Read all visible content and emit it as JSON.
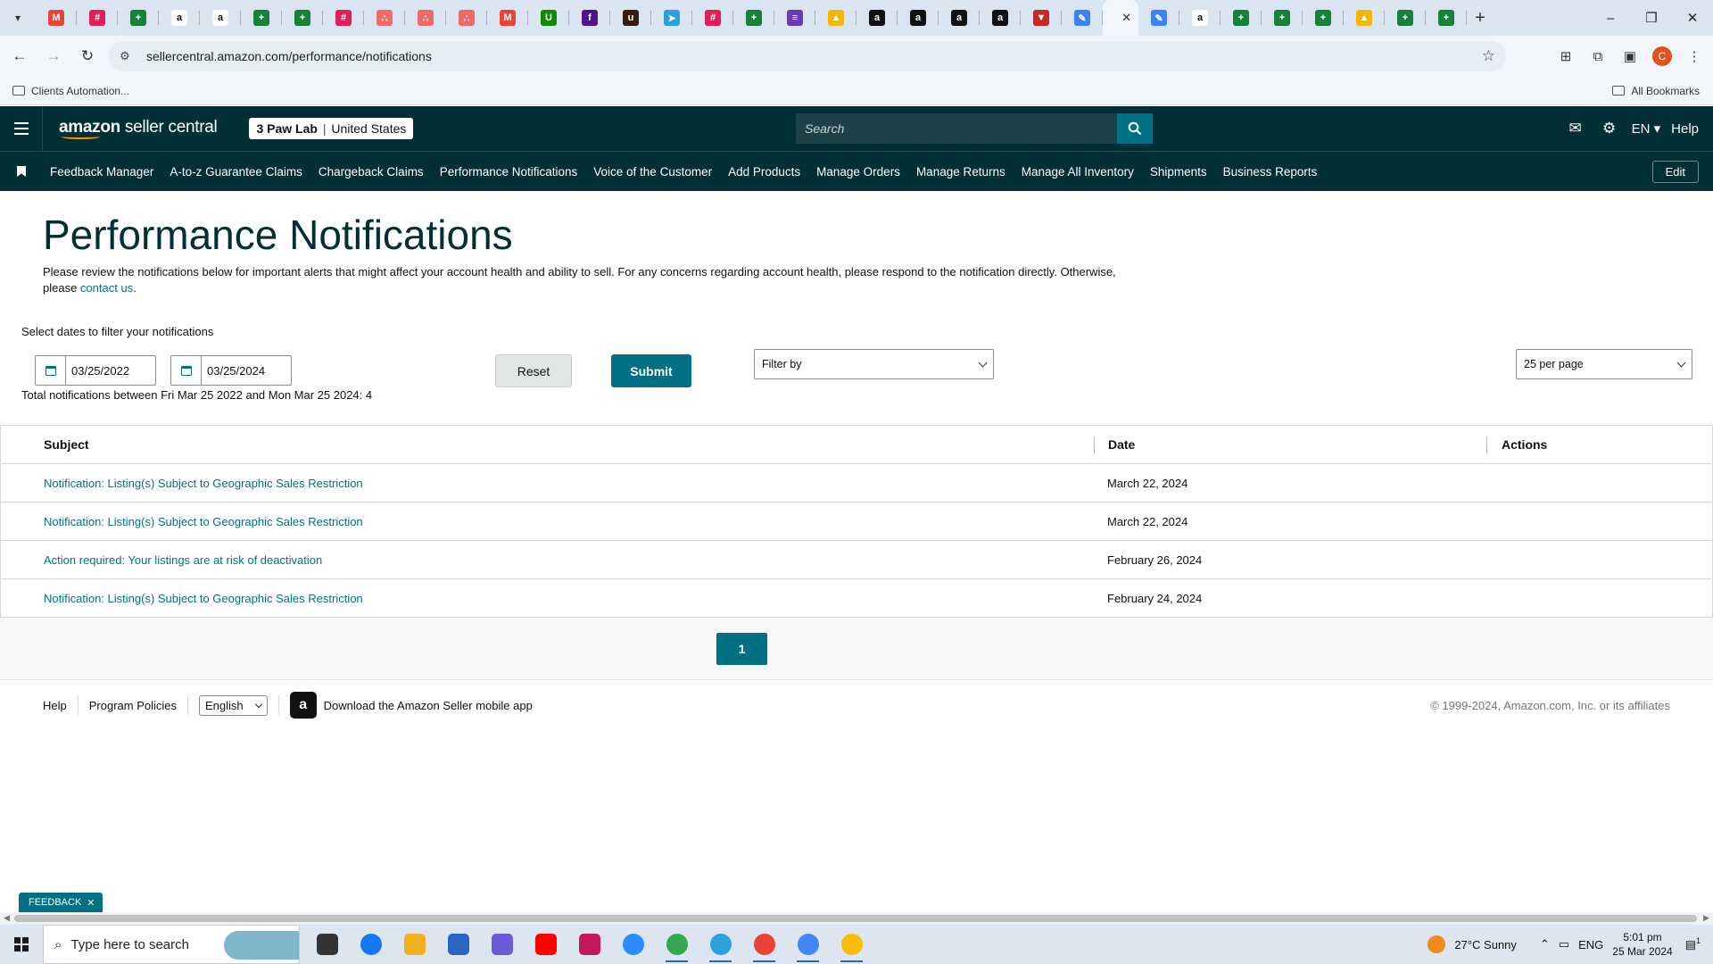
{
  "browser": {
    "url": "sellercentral.amazon.com/performance/notifications",
    "bookmarks": {
      "folder": "Clients Automation...",
      "all": "All Bookmarks"
    },
    "profile_initial": "C",
    "pinned_tabs": [
      {
        "icon": "gmail-icon",
        "color": "#ea4335",
        "glyph": "M"
      },
      {
        "icon": "slack-icon",
        "color": "#e01e5a",
        "glyph": "#"
      },
      {
        "icon": "sheets-icon",
        "color": "#188038",
        "glyph": "+"
      },
      {
        "icon": "amazon-icon",
        "color": "#ffffff",
        "glyph": "a"
      },
      {
        "icon": "amazon-icon",
        "color": "#ffffff",
        "glyph": "a"
      },
      {
        "icon": "sheets-icon",
        "color": "#188038",
        "glyph": "+"
      },
      {
        "icon": "sheets-icon",
        "color": "#188038",
        "glyph": "+"
      },
      {
        "icon": "slack-icon",
        "color": "#e01e5a",
        "glyph": "#"
      },
      {
        "icon": "asana-icon",
        "color": "#f06a6a",
        "glyph": "∴"
      },
      {
        "icon": "asana-icon",
        "color": "#f06a6a",
        "glyph": "∴"
      },
      {
        "icon": "asana-icon",
        "color": "#f06a6a",
        "glyph": "∴"
      },
      {
        "icon": "gmail-icon",
        "color": "#ea4335",
        "glyph": "M"
      },
      {
        "icon": "upwork-icon",
        "color": "#108a00",
        "glyph": "U"
      },
      {
        "icon": "fedex-icon",
        "color": "#4d148c",
        "glyph": "f"
      },
      {
        "icon": "ups-icon",
        "color": "#351c15",
        "glyph": "u"
      },
      {
        "icon": "telegram-icon",
        "color": "#2aa1da",
        "glyph": "➤"
      },
      {
        "icon": "slack-icon",
        "color": "#e01e5a",
        "glyph": "#"
      },
      {
        "icon": "sheets-icon",
        "color": "#188038",
        "glyph": "+"
      },
      {
        "icon": "forms-icon",
        "color": "#673ab7",
        "glyph": "≡"
      },
      {
        "icon": "drive-icon",
        "color": "#f4b400",
        "glyph": "▲"
      },
      {
        "icon": "amazon-icon",
        "color": "#111111",
        "glyph": "a"
      },
      {
        "icon": "amazon-icon",
        "color": "#111111",
        "glyph": "a"
      },
      {
        "icon": "amazon-icon",
        "color": "#111111",
        "glyph": "a"
      },
      {
        "icon": "amazon-icon",
        "color": "#111111",
        "glyph": "a"
      },
      {
        "icon": "red-shield-icon",
        "color": "#c62828",
        "glyph": "▼"
      },
      {
        "icon": "pencil-icon",
        "color": "#3b82f6",
        "glyph": "✎"
      },
      {
        "icon": "active-tab-icon",
        "color": "#f2f6fb",
        "glyph": "",
        "active": true
      },
      {
        "icon": "pencil-icon",
        "color": "#3b82f6",
        "glyph": "✎"
      },
      {
        "icon": "amazon-icon",
        "color": "#ffffff",
        "glyph": "a"
      },
      {
        "icon": "sheets-icon",
        "color": "#188038",
        "glyph": "+"
      },
      {
        "icon": "sheets-icon",
        "color": "#188038",
        "glyph": "+"
      },
      {
        "icon": "sheets-icon",
        "color": "#188038",
        "glyph": "+"
      },
      {
        "icon": "drive-icon",
        "color": "#f4b400",
        "glyph": "▲"
      },
      {
        "icon": "sheets-icon",
        "color": "#188038",
        "glyph": "+"
      },
      {
        "icon": "sheets-icon",
        "color": "#188038",
        "glyph": "+"
      }
    ]
  },
  "header": {
    "logo_bold": "amazon",
    "logo_rest": " seller central",
    "store_name": "3 Paw Lab",
    "store_sep": "|",
    "marketplace": "United States",
    "search_placeholder": "Search",
    "language": "EN",
    "help": "Help"
  },
  "nav": {
    "links": [
      "Feedback Manager",
      "A-to-z Guarantee Claims",
      "Chargeback Claims",
      "Performance Notifications",
      "Voice of the Customer",
      "Add Products",
      "Manage Orders",
      "Manage Returns",
      "Manage All Inventory",
      "Shipments",
      "Business Reports"
    ],
    "edit": "Edit"
  },
  "page": {
    "title": "Performance Notifications",
    "intro": "Please review the notifications below for important alerts that might affect your account health and ability to sell. For any concerns regarding account health, please respond to the notification directly. Otherwise, please ",
    "intro_link": "contact us",
    "intro_end": "."
  },
  "filters": {
    "label": "Select dates to filter your notifications",
    "from_date": "03/25/2022",
    "to_date": "03/25/2024",
    "reset": "Reset",
    "submit": "Submit",
    "filter_by": "Filter by",
    "per_page": "25 per page",
    "total": "Total notifications between Fri Mar 25 2022 and Mon Mar 25 2024: 4"
  },
  "table": {
    "headers": {
      "subject": "Subject",
      "date": "Date",
      "actions": "Actions"
    },
    "rows": [
      {
        "subject": "Notification: Listing(s) Subject to Geographic Sales Restriction",
        "date": "March 22, 2024"
      },
      {
        "subject": "Notification: Listing(s) Subject to Geographic Sales Restriction",
        "date": "March 22, 2024"
      },
      {
        "subject": "Action required: Your listings are at risk of deactivation",
        "date": "February 26, 2024"
      },
      {
        "subject": "Notification: Listing(s) Subject to Geographic Sales Restriction",
        "date": "February 24, 2024"
      }
    ]
  },
  "pagination": {
    "current": "1"
  },
  "footer": {
    "help": "Help",
    "policies": "Program Policies",
    "language": "English",
    "app_link": "Download the Amazon Seller mobile app",
    "copyright": "© 1999-2024, Amazon.com, Inc. or its affiliates"
  },
  "feedback": "FEEDBACK",
  "taskbar": {
    "search_placeholder": "Type here to search",
    "weather": "27°C  Sunny",
    "input_lang": "ENG",
    "time": "5:01 pm",
    "date": "25 Mar 2024",
    "notification_count": "1",
    "apps": [
      {
        "icon": "task-view-icon",
        "color": "#333333"
      },
      {
        "icon": "facebook-icon",
        "color": "#1877f2"
      },
      {
        "icon": "file-explorer-icon",
        "color": "#f2b01e"
      },
      {
        "icon": "calculator-icon",
        "color": "#2b65c4"
      },
      {
        "icon": "copilot-icon",
        "color": "#6b5bd6"
      },
      {
        "icon": "youtube-icon",
        "color": "#ff0000"
      },
      {
        "icon": "snipping-tool-icon",
        "color": "#c2185b"
      },
      {
        "icon": "zoom-icon",
        "color": "#2d8cff"
      },
      {
        "icon": "chrome-icon",
        "color": "#34a853"
      },
      {
        "icon": "telegram-icon",
        "color": "#2aa1da"
      },
      {
        "icon": "chrome-icon",
        "color": "#ea4335"
      },
      {
        "icon": "chrome-icon",
        "color": "#4285f4"
      },
      {
        "icon": "chrome-icon",
        "color": "#fbbc05"
      }
    ]
  }
}
